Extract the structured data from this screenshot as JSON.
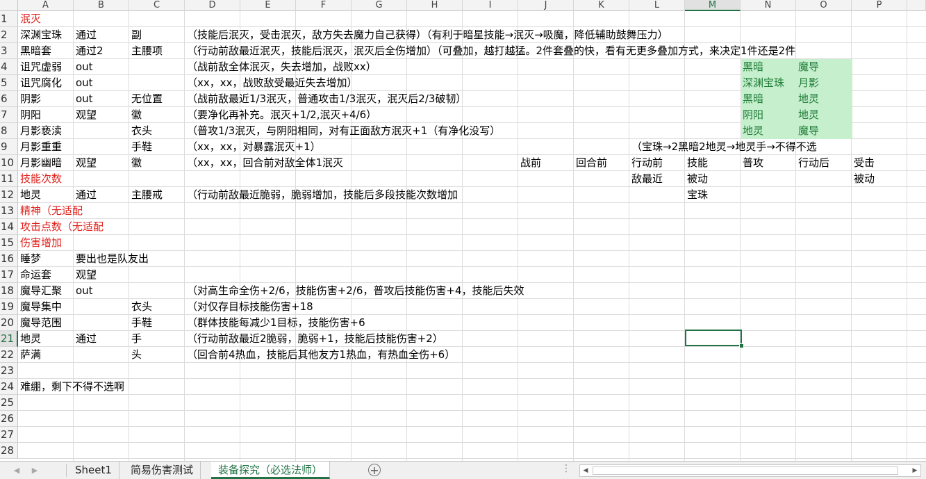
{
  "columns": [
    "A",
    "B",
    "C",
    "D",
    "E",
    "F",
    "G",
    "H",
    "I",
    "J",
    "K",
    "L",
    "M",
    "N",
    "O",
    "P"
  ],
  "selected_column": "M",
  "selected_row": 21,
  "rows": [
    "1",
    "2",
    "3",
    "4",
    "5",
    "6",
    "7",
    "8",
    "9",
    "10",
    "11",
    "12",
    "13",
    "14",
    "15",
    "16",
    "17",
    "18",
    "19",
    "20",
    "21",
    "22",
    "23",
    "24",
    "25",
    "26",
    "27",
    "28"
  ],
  "cells": [
    {
      "r": 1,
      "c": "A",
      "text": "泯灭",
      "color": "red"
    },
    {
      "r": 2,
      "c": "A",
      "text": "深渊宝珠"
    },
    {
      "r": 2,
      "c": "B",
      "text": "通过"
    },
    {
      "r": 2,
      "c": "C",
      "text": "副"
    },
    {
      "r": 2,
      "c": "D",
      "text": "（技能后泯灭，受击泯灭，敌方失去魔力自己获得）（有利于暗星技能→泯灭→吸魔，降低辅助鼓舞压力）"
    },
    {
      "r": 3,
      "c": "A",
      "text": "黑暗套"
    },
    {
      "r": 3,
      "c": "B",
      "text": "通过2"
    },
    {
      "r": 3,
      "c": "C",
      "text": "主腰项"
    },
    {
      "r": 3,
      "c": "D",
      "text": "（行动前敌最近泯灭，技能后泯灭，泯灭后全伤增加）（可叠加，越打越猛。2件套叠的快，看有无更多叠加方式，来决定1件还是2件"
    },
    {
      "r": 4,
      "c": "A",
      "text": "诅咒虚弱"
    },
    {
      "r": 4,
      "c": "B",
      "text": "out"
    },
    {
      "r": 4,
      "c": "D",
      "text": "（战前敌全体泯灭，失去增加，战败xx）"
    },
    {
      "r": 4,
      "c": "N",
      "text": "黑暗",
      "color": "green"
    },
    {
      "r": 4,
      "c": "O",
      "text": "魔导",
      "color": "green"
    },
    {
      "r": 5,
      "c": "A",
      "text": "诅咒腐化"
    },
    {
      "r": 5,
      "c": "B",
      "text": "out"
    },
    {
      "r": 5,
      "c": "D",
      "text": "（xx，xx，战败敌受最近失去增加）"
    },
    {
      "r": 5,
      "c": "N",
      "text": "深渊宝珠",
      "color": "green"
    },
    {
      "r": 5,
      "c": "O",
      "text": "月影",
      "color": "green"
    },
    {
      "r": 6,
      "c": "A",
      "text": "阴影"
    },
    {
      "r": 6,
      "c": "B",
      "text": "out"
    },
    {
      "r": 6,
      "c": "C",
      "text": "无位置"
    },
    {
      "r": 6,
      "c": "D",
      "text": "（战前敌最近1/3泯灭，普通攻击1/3泯灭，泯灭后2/3破韧）"
    },
    {
      "r": 6,
      "c": "N",
      "text": "黑暗",
      "color": "green"
    },
    {
      "r": 6,
      "c": "O",
      "text": "地灵",
      "color": "green"
    },
    {
      "r": 7,
      "c": "A",
      "text": "阴阳"
    },
    {
      "r": 7,
      "c": "B",
      "text": "观望"
    },
    {
      "r": 7,
      "c": "C",
      "text": "徽"
    },
    {
      "r": 7,
      "c": "D",
      "text": "（要净化再补充。泯灭+1/2,泯灭+4/6）"
    },
    {
      "r": 7,
      "c": "N",
      "text": "阴阳",
      "color": "green"
    },
    {
      "r": 7,
      "c": "O",
      "text": "地灵",
      "color": "green"
    },
    {
      "r": 8,
      "c": "A",
      "text": "月影亵渎"
    },
    {
      "r": 8,
      "c": "C",
      "text": "衣头"
    },
    {
      "r": 8,
      "c": "D",
      "text": "（普攻1/3泯灭，与阴阳相同，对有正面敌方泯灭+1（有净化没写）"
    },
    {
      "r": 8,
      "c": "N",
      "text": "地灵",
      "color": "green"
    },
    {
      "r": 8,
      "c": "O",
      "text": "魔导",
      "color": "green"
    },
    {
      "r": 9,
      "c": "A",
      "text": "月影重重"
    },
    {
      "r": 9,
      "c": "C",
      "text": "手鞋"
    },
    {
      "r": 9,
      "c": "D",
      "text": "（xx，xx，对暴露泯灭+1）"
    },
    {
      "r": 9,
      "c": "L",
      "text": "（宝珠→2黑暗2地灵→地灵手→不得不选"
    },
    {
      "r": 10,
      "c": "A",
      "text": "月影幽暗"
    },
    {
      "r": 10,
      "c": "B",
      "text": "观望"
    },
    {
      "r": 10,
      "c": "C",
      "text": "徽"
    },
    {
      "r": 10,
      "c": "D",
      "text": "（xx，xx，回合前对敌全体1泯灭"
    },
    {
      "r": 10,
      "c": "J",
      "text": "战前"
    },
    {
      "r": 10,
      "c": "K",
      "text": "回合前"
    },
    {
      "r": 10,
      "c": "L",
      "text": "行动前"
    },
    {
      "r": 10,
      "c": "M",
      "text": "技能"
    },
    {
      "r": 10,
      "c": "N",
      "text": "普攻"
    },
    {
      "r": 10,
      "c": "O",
      "text": "行动后"
    },
    {
      "r": 10,
      "c": "P",
      "text": "受击"
    },
    {
      "r": 11,
      "c": "A",
      "text": "技能次数",
      "color": "red"
    },
    {
      "r": 11,
      "c": "L",
      "text": "敌最近"
    },
    {
      "r": 11,
      "c": "M",
      "text": "被动"
    },
    {
      "r": 11,
      "c": "P",
      "text": "被动"
    },
    {
      "r": 12,
      "c": "A",
      "text": "地灵"
    },
    {
      "r": 12,
      "c": "B",
      "text": "通过"
    },
    {
      "r": 12,
      "c": "C",
      "text": "主腰戒"
    },
    {
      "r": 12,
      "c": "D",
      "text": "（行动前敌最近脆弱，脆弱增加，技能后多段技能次数增加"
    },
    {
      "r": 12,
      "c": "M",
      "text": "宝珠"
    },
    {
      "r": 13,
      "c": "A",
      "text": "精神（无适配",
      "color": "red"
    },
    {
      "r": 14,
      "c": "A",
      "text": "攻击点数（无适配",
      "color": "red"
    },
    {
      "r": 15,
      "c": "A",
      "text": "伤害增加",
      "color": "red"
    },
    {
      "r": 16,
      "c": "A",
      "text": "睡梦"
    },
    {
      "r": 16,
      "c": "B",
      "text": "要出也是队友出"
    },
    {
      "r": 17,
      "c": "A",
      "text": "命运套"
    },
    {
      "r": 17,
      "c": "B",
      "text": "观望"
    },
    {
      "r": 18,
      "c": "A",
      "text": "魔导汇聚"
    },
    {
      "r": 18,
      "c": "B",
      "text": "out"
    },
    {
      "r": 18,
      "c": "D",
      "text": "（对高生命全伤+2/6，技能伤害+2/6，普攻后技能伤害+4，技能后失效"
    },
    {
      "r": 19,
      "c": "A",
      "text": "魔导集中"
    },
    {
      "r": 19,
      "c": "C",
      "text": "衣头"
    },
    {
      "r": 19,
      "c": "D",
      "text": "（对仅存目标技能伤害+18"
    },
    {
      "r": 20,
      "c": "A",
      "text": "魔导范围"
    },
    {
      "r": 20,
      "c": "C",
      "text": "手鞋"
    },
    {
      "r": 20,
      "c": "D",
      "text": "（群体技能每减少1目标，技能伤害+6"
    },
    {
      "r": 21,
      "c": "A",
      "text": "地灵"
    },
    {
      "r": 21,
      "c": "B",
      "text": "通过"
    },
    {
      "r": 21,
      "c": "C",
      "text": "手"
    },
    {
      "r": 21,
      "c": "D",
      "text": "（行动前敌最近2脆弱，脆弱+1，技能后技能伤害+2）"
    },
    {
      "r": 22,
      "c": "A",
      "text": "萨满"
    },
    {
      "r": 22,
      "c": "C",
      "text": "头"
    },
    {
      "r": 22,
      "c": "D",
      "text": "（回合前4热血，技能后其他友方1热血，有热血全伤+6）"
    },
    {
      "r": 24,
      "c": "A",
      "text": "难绷，剩下不得不选啊"
    }
  ],
  "sheet_tabs": [
    {
      "label": "Sheet1",
      "active": false
    },
    {
      "label": "简易伤害测试",
      "active": false
    },
    {
      "label": "装备探究（必选法师）",
      "active": true
    }
  ],
  "icons": {
    "add_sheet": "add-sheet-icon",
    "nav_prev": "tab-scroll-left-icon",
    "nav_next": "tab-scroll-right-icon"
  },
  "colors": {
    "accent": "#217346",
    "red_text": "#e0201b",
    "green_text": "#1e7c36",
    "green_fill": "#c6efce"
  }
}
